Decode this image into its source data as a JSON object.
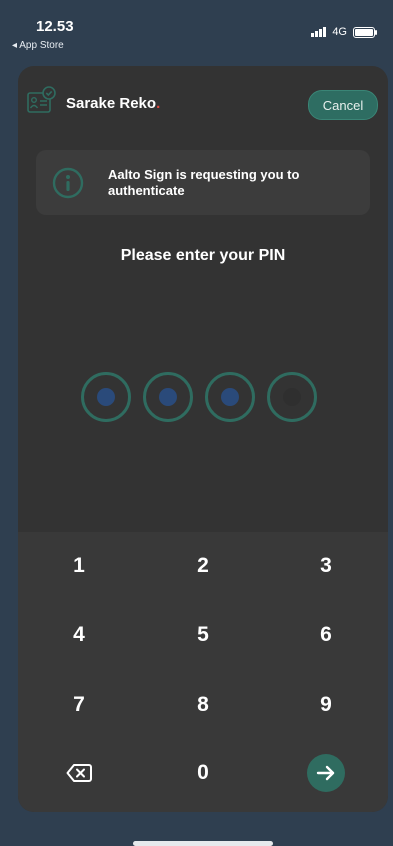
{
  "status": {
    "time": "12.53",
    "back_app": "◂ App Store",
    "network": "4G"
  },
  "header": {
    "app_name": "Sarake Reko",
    "app_name_dot": ".",
    "cancel_label": "Cancel"
  },
  "info": {
    "message": "Aalto Sign is requesting you to authenticate"
  },
  "prompt": "Please enter your PIN",
  "pin": {
    "length": 4,
    "filled": 3
  },
  "keypad": {
    "keys": [
      "1",
      "2",
      "3",
      "4",
      "5",
      "6",
      "7",
      "8",
      "9",
      "0"
    ]
  },
  "colors": {
    "accent": "#2f6c60",
    "filled_dot": "#2a4a7a",
    "brand_dot": "#e2453c"
  }
}
